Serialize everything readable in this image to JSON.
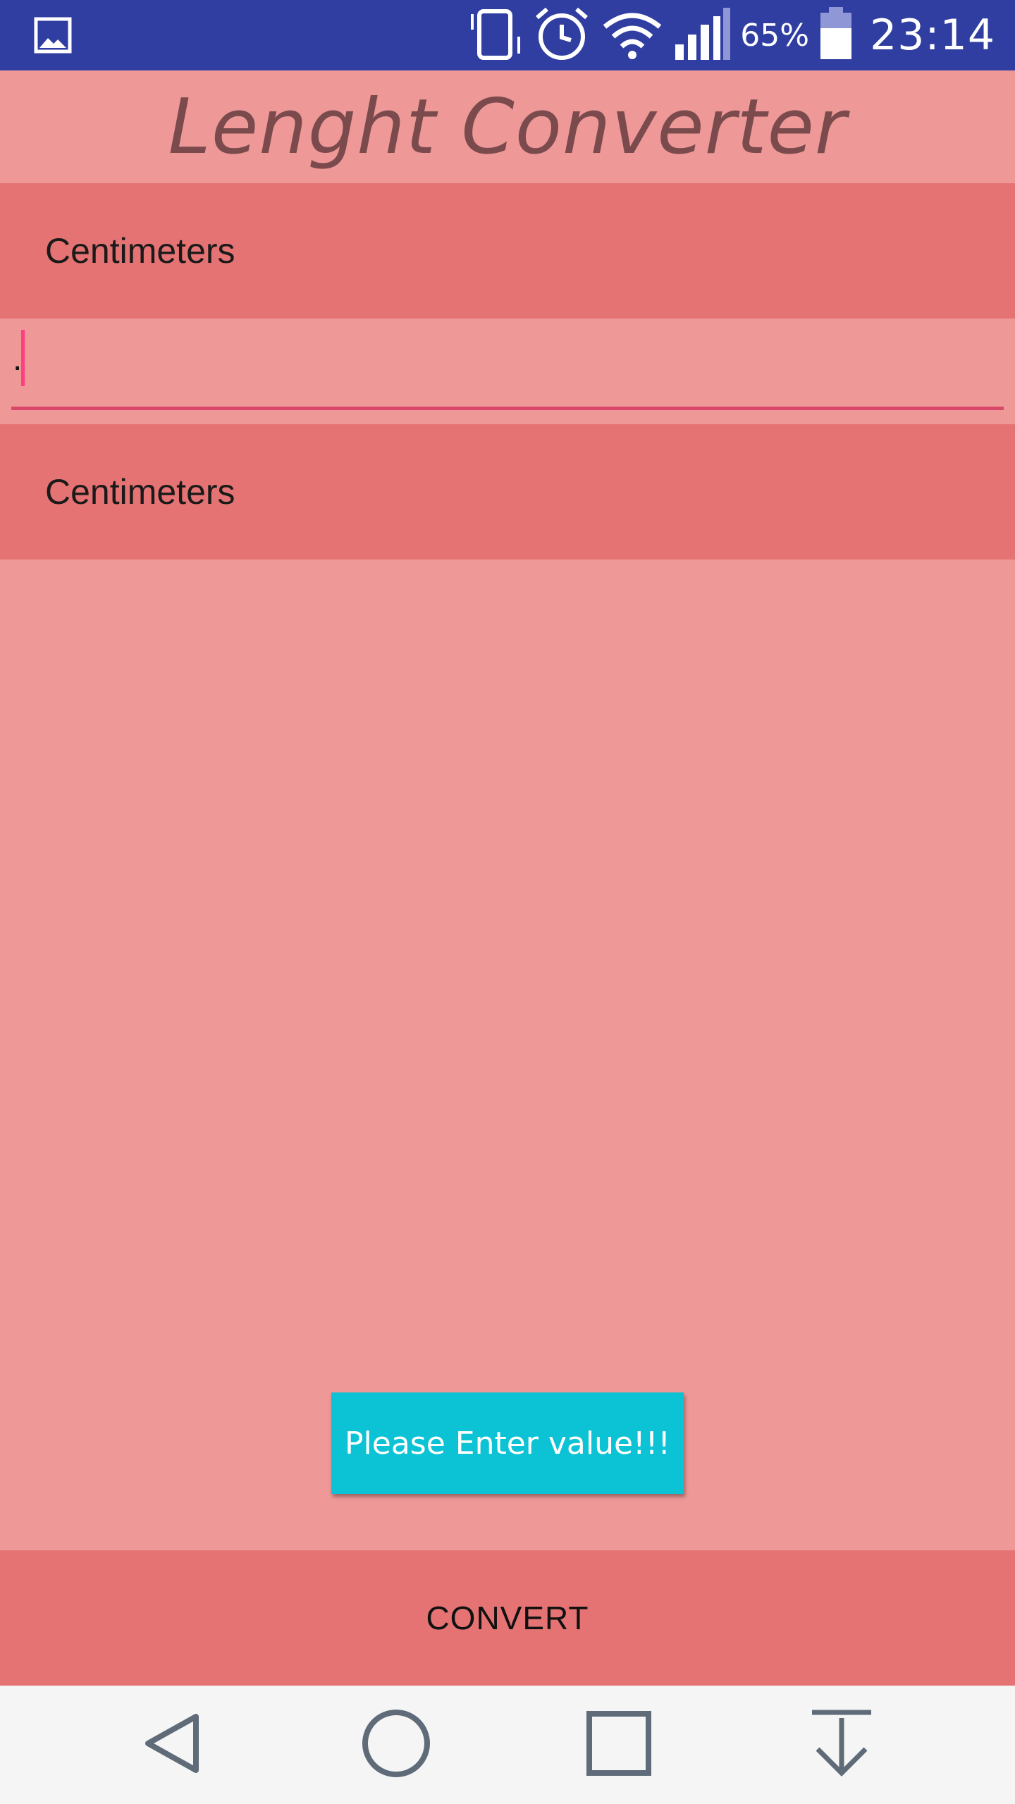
{
  "status_bar": {
    "battery_percent": "65%",
    "time": "23:14",
    "icons": [
      "gallery-icon",
      "vibrate-icon",
      "alarm-icon",
      "wifi-icon",
      "signal-icon",
      "battery-icon"
    ]
  },
  "app": {
    "title": "Lenght Converter"
  },
  "from_unit": {
    "selected": "Centimeters"
  },
  "value_input": {
    "value": "."
  },
  "to_unit": {
    "selected": "Centimeters"
  },
  "toast": {
    "message": "Please Enter value!!!"
  },
  "convert_button": {
    "label": "CONVERT"
  },
  "nav_bar": {
    "icons": [
      "back-icon",
      "home-icon",
      "recents-icon",
      "download-icon"
    ]
  },
  "colors": {
    "status_bar": "#2f3ea0",
    "background": "#ee9898",
    "spinner_bg": "#e57373",
    "title_text": "#7a4a4c",
    "input_underline": "#d9486a",
    "toast_bg": "#0bc3d4",
    "nav_bar": "#f5f5f5"
  }
}
